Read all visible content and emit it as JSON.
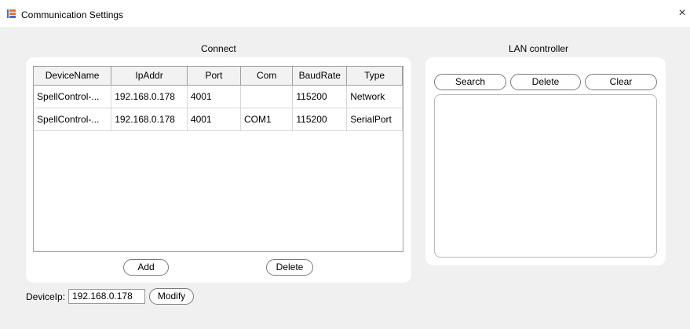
{
  "window": {
    "title": "Communication Settings",
    "close_glyph": "×",
    "app_icon": "app-logo-icon",
    "close_icon": "close-icon"
  },
  "connect": {
    "title": "Connect",
    "columns": [
      "DeviceName",
      "IpAddr",
      "Port",
      "Com",
      "BaudRate",
      "Type"
    ],
    "rows": [
      [
        "SpellControl-...",
        "192.168.0.178",
        "4001",
        "",
        "115200",
        "Network"
      ],
      [
        "SpellControl-...",
        "192.168.0.178",
        "4001",
        "COM1",
        "115200",
        "SerialPort"
      ]
    ],
    "add_label": "Add",
    "delete_label": "Delete"
  },
  "lan": {
    "title": "LAN controller",
    "search_label": "Search",
    "delete_label": "Delete",
    "clear_label": "Clear"
  },
  "device_ip": {
    "label": "DeviceIp:",
    "value": "192.168.0.178",
    "modify_label": "Modify"
  },
  "colors": {
    "panel": "#ffffff",
    "background": "#f0f0f0",
    "icon_orange": "#e8742a",
    "icon_blue": "#3b6fd6"
  }
}
